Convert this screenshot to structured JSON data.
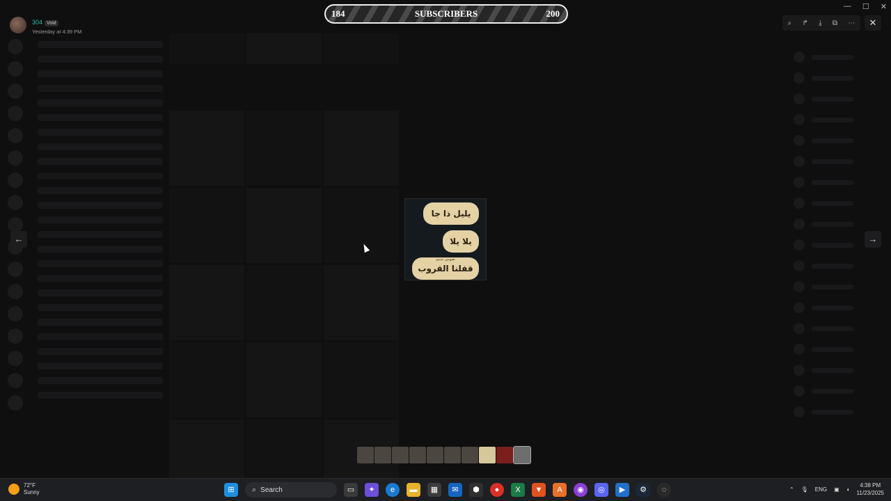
{
  "header": {
    "username": "304",
    "badge": "Void",
    "timestamp": "Yesterday at 4:39 PM"
  },
  "counter": {
    "current": "184",
    "label": "SUBSCRIBERS",
    "goal": "200"
  },
  "toolbar": {
    "zoom": "zoom-in-icon",
    "forward": "forward-icon",
    "download": "download-icon",
    "open": "open-external-icon",
    "more": "more-icon"
  },
  "image_text": {
    "line1": "يليل ذا جا",
    "line2": "يلا يلا",
    "line3": "قفلنا القروب",
    "small": "صوتي نديم"
  },
  "taskbar": {
    "weather_temp": "72°F",
    "weather_desc": "Sunny",
    "search_placeholder": "Search",
    "language": "ENG",
    "time": "4:38 PM",
    "date": "11/23/2025"
  },
  "colors": {
    "counter_border": "#eeeeee",
    "bubble": "#e4d1a4",
    "username": "#2fb8a8"
  }
}
